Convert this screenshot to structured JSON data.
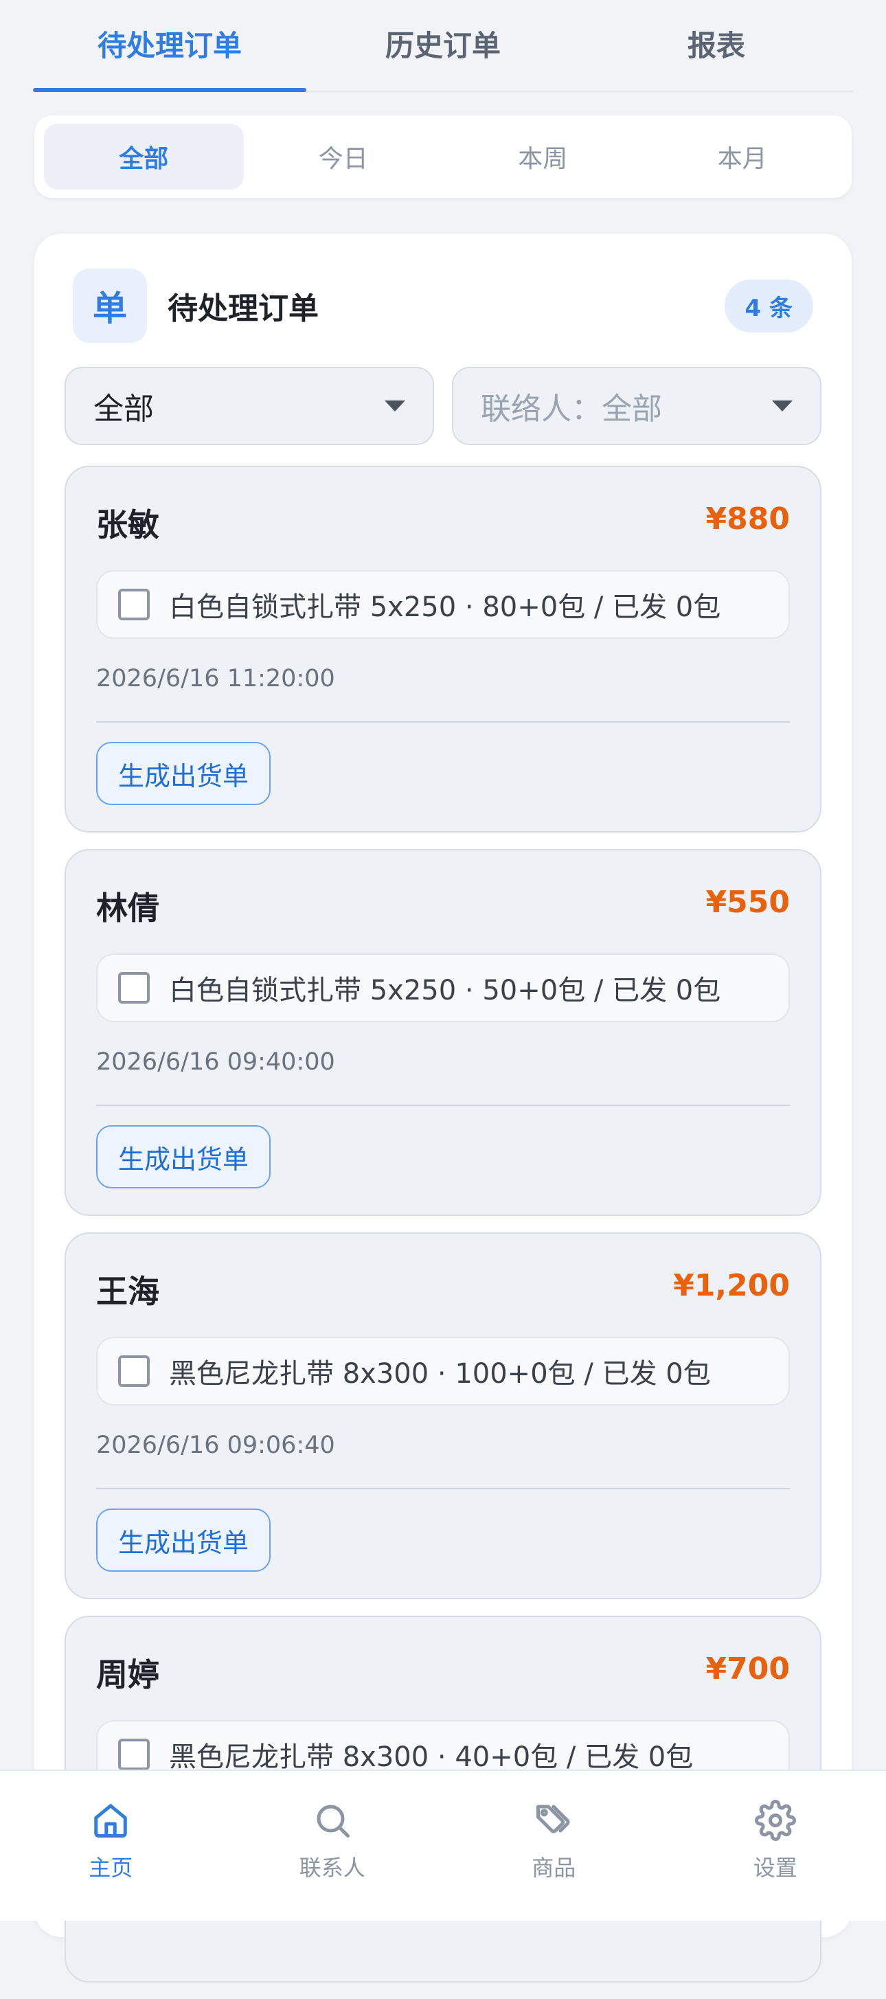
{
  "top_tabs": [
    {
      "label": "待处理订单",
      "active": true
    },
    {
      "label": "历史订单",
      "active": false
    },
    {
      "label": "报表",
      "active": false
    }
  ],
  "range_filter": [
    {
      "label": "全部",
      "active": true
    },
    {
      "label": "今日",
      "active": false
    },
    {
      "label": "本周",
      "active": false
    },
    {
      "label": "本月",
      "active": false
    }
  ],
  "card": {
    "icon_char": "单",
    "title": "待处理订单",
    "count_badge": "4 条",
    "status_select": "全部",
    "contact_select": "联络人：全部"
  },
  "orders": [
    {
      "name": "张敏",
      "amount": "¥880",
      "item": "白色自锁式扎带 5x250 · 80+0包 / 已发 0包",
      "time": "2026/6/16 11:20:00",
      "action": "生成出货单"
    },
    {
      "name": "林倩",
      "amount": "¥550",
      "item": "白色自锁式扎带 5x250 · 50+0包 / 已发 0包",
      "time": "2026/6/16 09:40:00",
      "action": "生成出货单"
    },
    {
      "name": "王海",
      "amount": "¥1,200",
      "item": "黑色尼龙扎带 8x300 · 100+0包 / 已发 0包",
      "time": "2026/6/16 09:06:40",
      "action": "生成出货单"
    },
    {
      "name": "周婷",
      "amount": "¥700",
      "item": "黑色尼龙扎带 8x300 · 40+0包 / 已发 0包",
      "time": "",
      "action": ""
    }
  ],
  "bottom_nav": [
    {
      "label": "主页",
      "icon": "home-icon",
      "active": true
    },
    {
      "label": "联系人",
      "icon": "search-icon",
      "active": false
    },
    {
      "label": "商品",
      "icon": "tag-icon",
      "active": false
    },
    {
      "label": "设置",
      "icon": "gear-icon",
      "active": false
    }
  ],
  "colors": {
    "accent": "#2f7de0",
    "amount": "#e8620e",
    "background": "#f1f3f7"
  }
}
